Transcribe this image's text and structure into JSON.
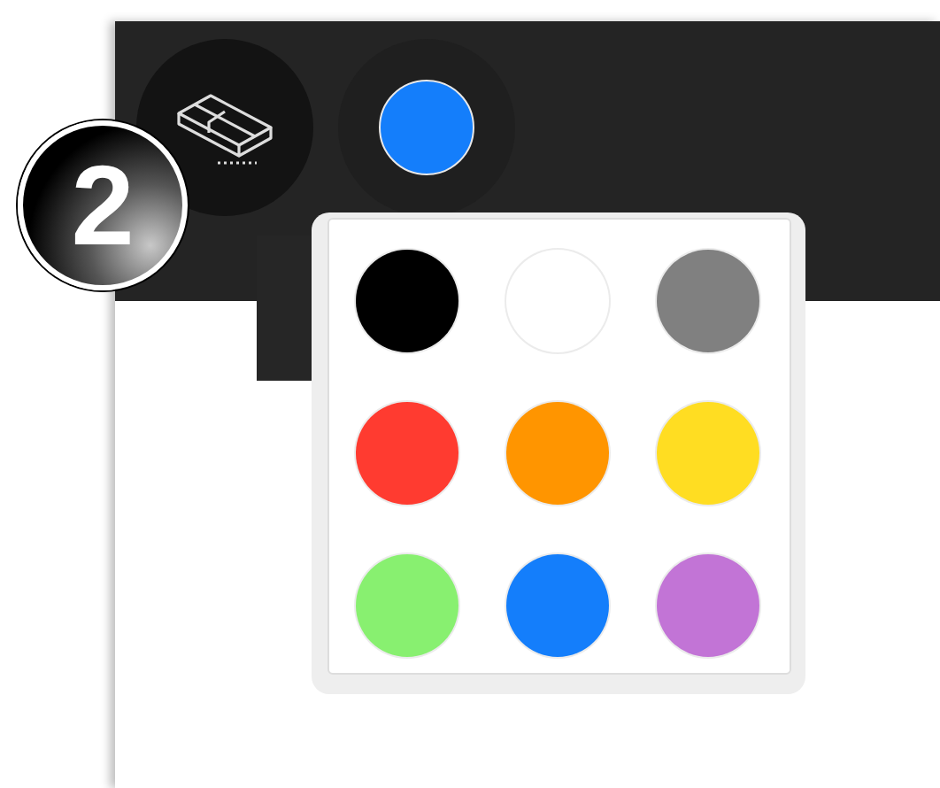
{
  "toolbar": {
    "step_badge": "2",
    "eraser": {
      "selected": true
    },
    "color_button": {
      "color": "#147efb"
    }
  },
  "palette": {
    "swatches": [
      {
        "color": "#000000"
      },
      {
        "color": "#ffffff"
      },
      {
        "color": "#808080"
      },
      {
        "color": "#ff3b30"
      },
      {
        "color": "#ff9500"
      },
      {
        "color": "#ffdd22"
      },
      {
        "color": "#88f070"
      },
      {
        "color": "#147efb"
      },
      {
        "color": "#c274d6"
      }
    ]
  }
}
